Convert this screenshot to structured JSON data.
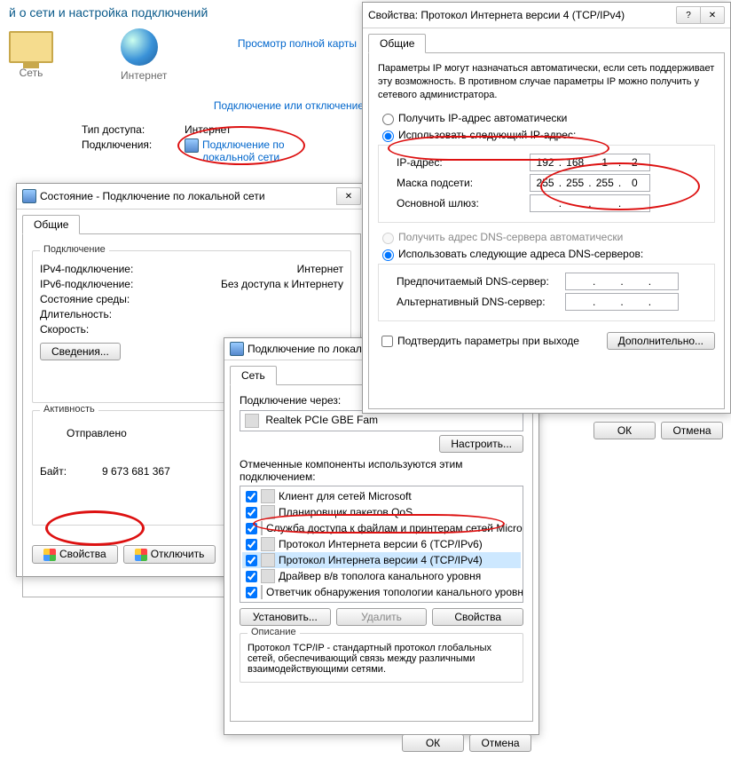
{
  "netcenter": {
    "heading": "й о сети и настройка подключений",
    "view_map": "Просмотр полной карты",
    "label_net": "Сеть",
    "label_internet": "Интернет",
    "conn_or_disc": "Подключение или отключение",
    "access_type_label": "Тип доступа:",
    "access_type_value": "Интернет",
    "connections_label": "Подключения:",
    "connection_link1": "Подключение по",
    "connection_link2": "локальной сети"
  },
  "win_status": {
    "title": "Состояние - Подключение по локальной сети",
    "tab_general": "Общие",
    "group_connection": "Подключение",
    "ipv4_label": "IPv4-подключение:",
    "ipv4_value": "Интернет",
    "ipv6_label": "IPv6-подключение:",
    "ipv6_value": "Без доступа к Интернету",
    "media_label": "Состояние среды:",
    "duration_label": "Длительность:",
    "speed_label": "Скорость:",
    "details_btn": "Сведения...",
    "group_activity": "Активность",
    "sent_label": "Отправлено",
    "bytes_label": "Байт:",
    "bytes_value": "9 673 681 367",
    "properties_btn": "Свойства",
    "disable_btn": "Отключить"
  },
  "win_conn": {
    "title": "Подключение по локаль",
    "tab_net": "Сеть",
    "connect_via": "Подключение через:",
    "adapter": "Realtek PCIe GBE Fam",
    "configure_btn": "Настроить...",
    "components_label": "Отмеченные компоненты используются этим подключением:",
    "items": [
      "Клиент для сетей Microsoft",
      "Планировщик пакетов QoS",
      "Служба доступа к файлам и принтерам сетей Micro...",
      "Протокол Интернета версии 6 (TCP/IPv6)",
      "Протокол Интернета версии 4 (TCP/IPv4)",
      "Драйвер в/в тополога канального уровня",
      "Ответчик обнаружения топологии канального уровня"
    ],
    "install_btn": "Установить...",
    "remove_btn": "Удалить",
    "properties_btn": "Свойства",
    "desc_group": "Описание",
    "desc_text": "Протокол TCP/IP - стандартный протокол глобальных сетей, обеспечивающий связь между различными взаимодействующими сетями.",
    "ok_btn": "ОК",
    "cancel_btn": "Отмена"
  },
  "win_ipv4": {
    "title": "Свойства: Протокол Интернета версии 4 (TCP/IPv4)",
    "tab_general": "Общие",
    "intro": "Параметры IP могут назначаться автоматически, если сеть поддерживает эту возможность. В противном случае параметры IP можно получить у сетевого администратора.",
    "opt_auto_ip": "Получить IP-адрес автоматически",
    "opt_manual_ip": "Использовать следующий IP-адрес:",
    "ip_label": "IP-адрес:",
    "mask_label": "Маска подсети:",
    "gw_label": "Основной шлюз:",
    "ip": {
      "a": "192",
      "b": "168",
      "c": "1",
      "d": "2"
    },
    "mask": {
      "a": "255",
      "b": "255",
      "c": "255",
      "d": "0"
    },
    "opt_auto_dns": "Получить адрес DNS-сервера автоматически",
    "opt_manual_dns": "Использовать следующие адреса DNS-серверов:",
    "dns1_label": "Предпочитаемый DNS-сервер:",
    "dns2_label": "Альтернативный DNS-сервер:",
    "confirm_exit": "Подтвердить параметры при выходе",
    "advanced_btn": "Дополнительно...",
    "ok_btn": "ОК",
    "cancel_btn": "Отмена"
  }
}
